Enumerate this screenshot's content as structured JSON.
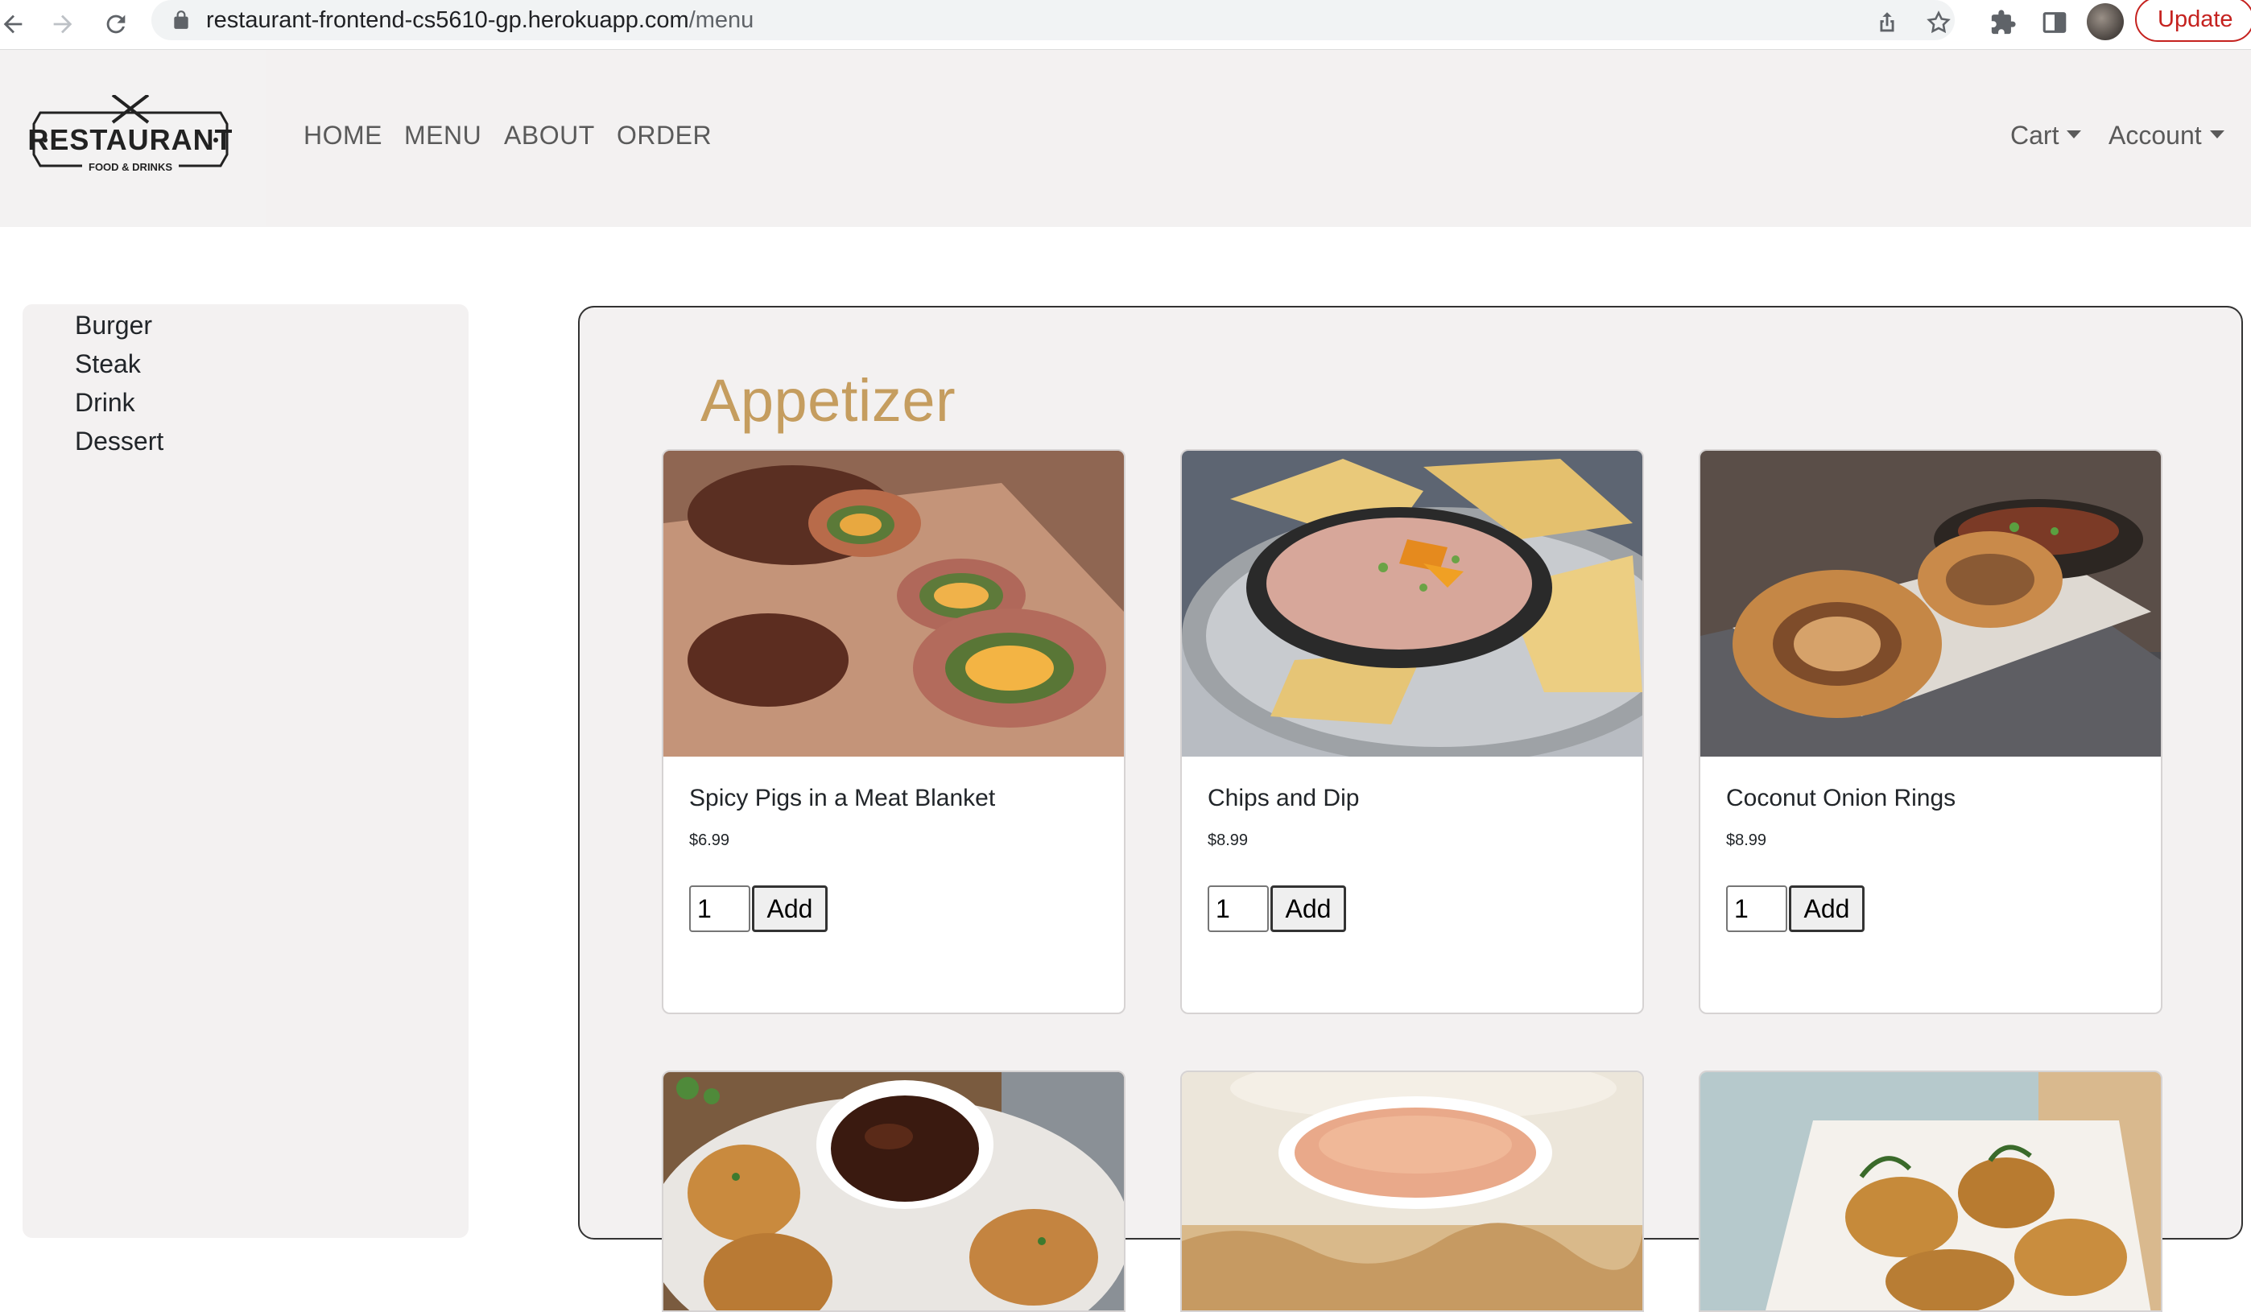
{
  "browser": {
    "url_host": "restaurant-frontend-cs5610-gp.herokuapp.com",
    "url_path": "/menu",
    "update_label": "Update"
  },
  "navbar": {
    "logo_text": "RESTAURANT",
    "logo_subtext": "FOOD & DRINKS",
    "links": [
      "HOME",
      "MENU",
      "ABOUT",
      "ORDER"
    ],
    "cart_label": "Cart",
    "account_label": "Account"
  },
  "sidebar": {
    "items": [
      "Burger",
      "Steak",
      "Drink",
      "Dessert"
    ]
  },
  "menu": {
    "section_title": "Appetizer",
    "items": [
      {
        "name": "Spicy Pigs in a Meat Blanket",
        "price": "$6.99",
        "qty": "1",
        "add_label": "Add"
      },
      {
        "name": "Chips and Dip",
        "price": "$8.99",
        "qty": "1",
        "add_label": "Add"
      },
      {
        "name": "Coconut Onion Rings",
        "price": "$8.99",
        "qty": "1",
        "add_label": "Add"
      }
    ]
  },
  "colors": {
    "accent_gold": "#c59d5f",
    "navbar_bg": "#f3f1f1",
    "update_red": "#c5221f"
  }
}
